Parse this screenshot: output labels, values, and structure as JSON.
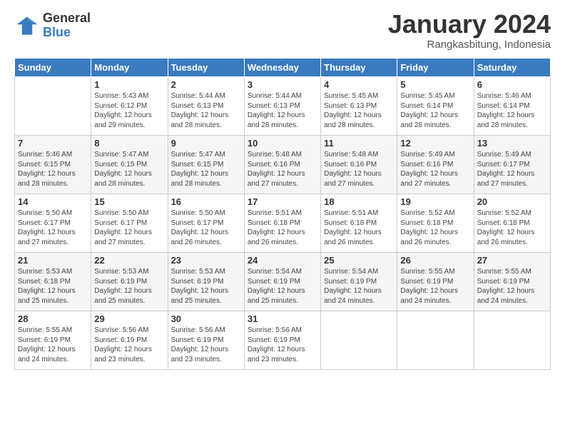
{
  "header": {
    "logo_general": "General",
    "logo_blue": "Blue",
    "month_year": "January 2024",
    "location": "Rangkasbitung, Indonesia"
  },
  "weekdays": [
    "Sunday",
    "Monday",
    "Tuesday",
    "Wednesday",
    "Thursday",
    "Friday",
    "Saturday"
  ],
  "weeks": [
    [
      {
        "day": "",
        "text": ""
      },
      {
        "day": "1",
        "text": "Sunrise: 5:43 AM\nSunset: 6:12 PM\nDaylight: 12 hours\nand 29 minutes."
      },
      {
        "day": "2",
        "text": "Sunrise: 5:44 AM\nSunset: 6:13 PM\nDaylight: 12 hours\nand 28 minutes."
      },
      {
        "day": "3",
        "text": "Sunrise: 5:44 AM\nSunset: 6:13 PM\nDaylight: 12 hours\nand 28 minutes."
      },
      {
        "day": "4",
        "text": "Sunrise: 5:45 AM\nSunset: 6:13 PM\nDaylight: 12 hours\nand 28 minutes."
      },
      {
        "day": "5",
        "text": "Sunrise: 5:45 AM\nSunset: 6:14 PM\nDaylight: 12 hours\nand 28 minutes."
      },
      {
        "day": "6",
        "text": "Sunrise: 5:46 AM\nSunset: 6:14 PM\nDaylight: 12 hours\nand 28 minutes."
      }
    ],
    [
      {
        "day": "7",
        "text": "Sunrise: 5:46 AM\nSunset: 6:15 PM\nDaylight: 12 hours\nand 28 minutes."
      },
      {
        "day": "8",
        "text": "Sunrise: 5:47 AM\nSunset: 6:15 PM\nDaylight: 12 hours\nand 28 minutes."
      },
      {
        "day": "9",
        "text": "Sunrise: 5:47 AM\nSunset: 6:15 PM\nDaylight: 12 hours\nand 28 minutes."
      },
      {
        "day": "10",
        "text": "Sunrise: 5:48 AM\nSunset: 6:16 PM\nDaylight: 12 hours\nand 27 minutes."
      },
      {
        "day": "11",
        "text": "Sunrise: 5:48 AM\nSunset: 6:16 PM\nDaylight: 12 hours\nand 27 minutes."
      },
      {
        "day": "12",
        "text": "Sunrise: 5:49 AM\nSunset: 6:16 PM\nDaylight: 12 hours\nand 27 minutes."
      },
      {
        "day": "13",
        "text": "Sunrise: 5:49 AM\nSunset: 6:17 PM\nDaylight: 12 hours\nand 27 minutes."
      }
    ],
    [
      {
        "day": "14",
        "text": "Sunrise: 5:50 AM\nSunset: 6:17 PM\nDaylight: 12 hours\nand 27 minutes."
      },
      {
        "day": "15",
        "text": "Sunrise: 5:50 AM\nSunset: 6:17 PM\nDaylight: 12 hours\nand 27 minutes."
      },
      {
        "day": "16",
        "text": "Sunrise: 5:50 AM\nSunset: 6:17 PM\nDaylight: 12 hours\nand 26 minutes."
      },
      {
        "day": "17",
        "text": "Sunrise: 5:51 AM\nSunset: 6:18 PM\nDaylight: 12 hours\nand 26 minutes."
      },
      {
        "day": "18",
        "text": "Sunrise: 5:51 AM\nSunset: 6:18 PM\nDaylight: 12 hours\nand 26 minutes."
      },
      {
        "day": "19",
        "text": "Sunrise: 5:52 AM\nSunset: 6:18 PM\nDaylight: 12 hours\nand 26 minutes."
      },
      {
        "day": "20",
        "text": "Sunrise: 5:52 AM\nSunset: 6:18 PM\nDaylight: 12 hours\nand 26 minutes."
      }
    ],
    [
      {
        "day": "21",
        "text": "Sunrise: 5:53 AM\nSunset: 6:18 PM\nDaylight: 12 hours\nand 25 minutes."
      },
      {
        "day": "22",
        "text": "Sunrise: 5:53 AM\nSunset: 6:19 PM\nDaylight: 12 hours\nand 25 minutes."
      },
      {
        "day": "23",
        "text": "Sunrise: 5:53 AM\nSunset: 6:19 PM\nDaylight: 12 hours\nand 25 minutes."
      },
      {
        "day": "24",
        "text": "Sunrise: 5:54 AM\nSunset: 6:19 PM\nDaylight: 12 hours\nand 25 minutes."
      },
      {
        "day": "25",
        "text": "Sunrise: 5:54 AM\nSunset: 6:19 PM\nDaylight: 12 hours\nand 24 minutes."
      },
      {
        "day": "26",
        "text": "Sunrise: 5:55 AM\nSunset: 6:19 PM\nDaylight: 12 hours\nand 24 minutes."
      },
      {
        "day": "27",
        "text": "Sunrise: 5:55 AM\nSunset: 6:19 PM\nDaylight: 12 hours\nand 24 minutes."
      }
    ],
    [
      {
        "day": "28",
        "text": "Sunrise: 5:55 AM\nSunset: 6:19 PM\nDaylight: 12 hours\nand 24 minutes."
      },
      {
        "day": "29",
        "text": "Sunrise: 5:56 AM\nSunset: 6:19 PM\nDaylight: 12 hours\nand 23 minutes."
      },
      {
        "day": "30",
        "text": "Sunrise: 5:56 AM\nSunset: 6:19 PM\nDaylight: 12 hours\nand 23 minutes."
      },
      {
        "day": "31",
        "text": "Sunrise: 5:56 AM\nSunset: 6:19 PM\nDaylight: 12 hours\nand 23 minutes."
      },
      {
        "day": "",
        "text": ""
      },
      {
        "day": "",
        "text": ""
      },
      {
        "day": "",
        "text": ""
      }
    ]
  ]
}
